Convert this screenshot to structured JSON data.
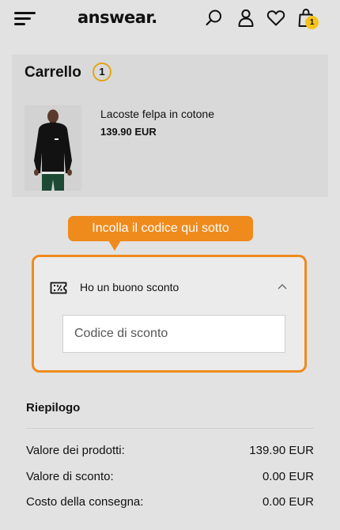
{
  "header": {
    "logo": "answear.",
    "cart_count": "1"
  },
  "cart": {
    "title": "Carrello",
    "count": "1",
    "product": {
      "name": "Lacoste felpa in cotone",
      "price": "139.90 EUR"
    }
  },
  "tooltip": {
    "text": "Incolla il codice qui sotto"
  },
  "voucher": {
    "label": "Ho un buono sconto",
    "input_placeholder": "Codice di sconto"
  },
  "summary": {
    "title": "Riepilogo",
    "rows": [
      {
        "label": "Valore dei prodotti:",
        "value": "139.90 EUR"
      },
      {
        "label": "Valore di sconto:",
        "value": "0.00 EUR"
      },
      {
        "label": "Costo della consegna:",
        "value": "0.00 EUR"
      }
    ]
  },
  "colors": {
    "accent": "#ef8a1c",
    "badge": "#f6c31a",
    "background": "#e2e2e2"
  }
}
